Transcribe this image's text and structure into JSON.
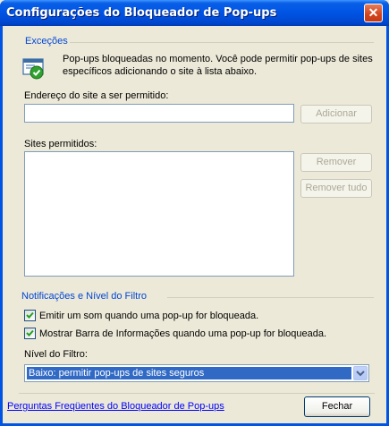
{
  "window": {
    "title": "Configurações do Bloqueador de Pop-ups",
    "close_glyph": "✕"
  },
  "exceptions": {
    "section_title": "Exceções",
    "info_text": "Pop-ups bloqueadas no momento.  Você pode permitir pop-ups de sites específicos adicionando o site à lista abaixo.",
    "address_label": "Endereço do site a ser permitido:",
    "address_value": "",
    "add_button": "Adicionar",
    "allowed_label": "Sites permitidos:",
    "allowed_sites": [],
    "remove_button": "Remover",
    "remove_all_button": "Remover tudo"
  },
  "notifications": {
    "section_title": "Notificações e Nível do Filtro",
    "play_sound": {
      "label": "Emitir um som quando uma pop-up for bloqueada.",
      "checked": true
    },
    "show_infobar": {
      "label": "Mostrar Barra de Informações quando uma pop-up for bloqueada.",
      "checked": true
    },
    "filter_label": "Nível do Filtro:",
    "filter_value": "Baixo: permitir pop-ups de sites seguros"
  },
  "footer": {
    "faq_link": "Perguntas Freqüentes do Bloqueador de Pop-ups",
    "close_button": "Fechar"
  },
  "colors": {
    "title_bar": "#0054e3",
    "section_title": "#0046d5",
    "dialog_bg": "#ece9d8",
    "selection": "#316ac5"
  }
}
